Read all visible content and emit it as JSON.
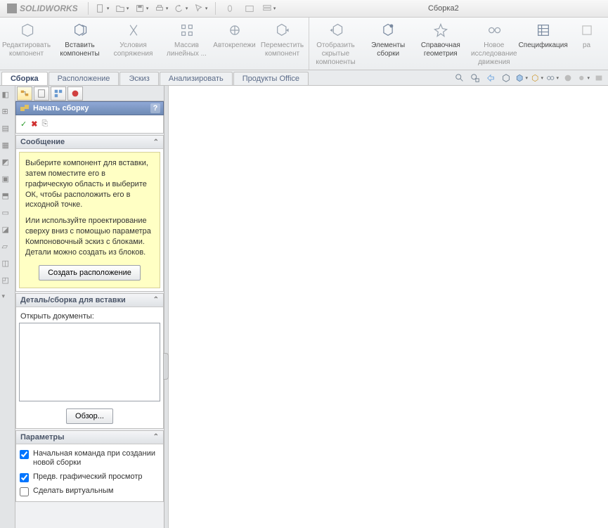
{
  "app": {
    "logo_text": "SOLIDWORKS",
    "doc_title": "Сборка2"
  },
  "ribbon": [
    {
      "label": "Редактировать компонент",
      "dim": true
    },
    {
      "label": "Вставить компоненты"
    },
    {
      "label": "Условия сопряжения",
      "dim": true
    },
    {
      "label": "Массив линейных ...",
      "dim": true
    },
    {
      "label": "Автокрепежи",
      "dim": true
    },
    {
      "label": "Переместить компонент",
      "dim": true,
      "sep": true
    },
    {
      "label": "Отобразить скрытые компоненты",
      "dim": true
    },
    {
      "label": "Элементы сборки"
    },
    {
      "label": "Справочная геометрия"
    },
    {
      "label": "Новое исследование движения",
      "dim": true
    },
    {
      "label": "Спецификация"
    },
    {
      "label": "ра",
      "dim": true
    }
  ],
  "tabs": [
    {
      "label": "Сборка",
      "active": true
    },
    {
      "label": "Расположение"
    },
    {
      "label": "Эскиз"
    },
    {
      "label": "Анализировать"
    },
    {
      "label": "Продукты Office"
    }
  ],
  "pm": {
    "title": "Начать сборку",
    "help": "?",
    "msg_header": "Сообщение",
    "msg_p1": "Выберите компонент для вставки, затем поместите его в графическую область и выберите ОК, чтобы расположить его в исходной точке.",
    "msg_p2": "Или используйте проектирование сверху вниз с помощью параметра Компоновочный эскиз с блоками. Детали можно создать из блоков.",
    "btn_layout": "Создать расположение",
    "insert_header": "Деталь/сборка для вставки",
    "open_docs_label": "Открыть документы:",
    "btn_browse": "Обзор...",
    "params_header": "Параметры",
    "chk1": "Начальная команда при создании новой сборки",
    "chk2": "Предв. графический просмотр",
    "chk3": "Сделать виртуальным"
  },
  "icons": {
    "ok": "✓",
    "cancel": "✖",
    "pin": "⎘"
  }
}
